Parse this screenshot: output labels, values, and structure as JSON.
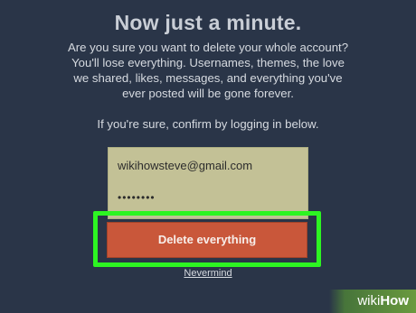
{
  "header": {
    "title": "Now just a minute."
  },
  "content": {
    "warning_text": "Are you sure you want to delete your whole account? You'll lose everything. Usernames, themes, the love we shared, likes, messages, and everything you've ever posted will be gone forever.",
    "confirm_text": "If you're sure, confirm by logging in below."
  },
  "form": {
    "email_value": "wikihowsteve@gmail.com",
    "password_value": "••••••••",
    "delete_button_label": "Delete everything",
    "nevermind_label": "Nevermind"
  },
  "watermark": {
    "prefix": "wiki",
    "suffix": "How"
  },
  "colors": {
    "background": "#2a3548",
    "form_box": "#c3c196",
    "delete_button": "#c9573a",
    "highlight": "#2df522"
  }
}
